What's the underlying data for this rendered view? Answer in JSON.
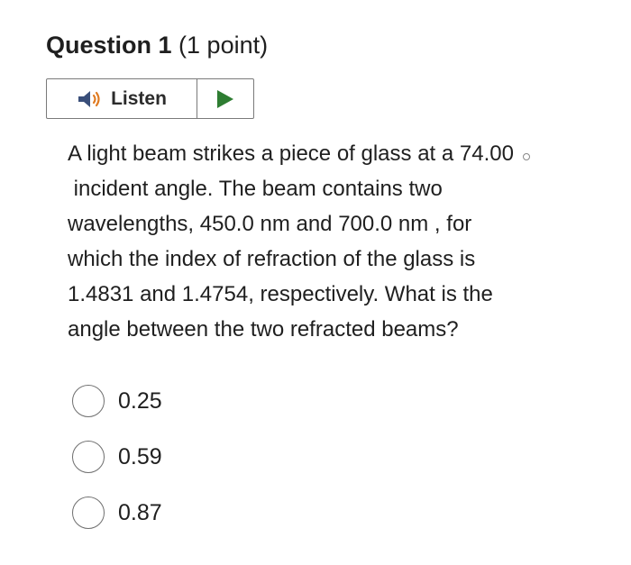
{
  "question": {
    "number_label": "Question 1",
    "points_label": "(1 point)"
  },
  "listen": {
    "label": "Listen",
    "speaker_icon": "speaker-icon",
    "play_icon": "play-icon",
    "play_color": "#2e7d32"
  },
  "body": {
    "line1": "A light beam strikes a piece of glass at a 74.00",
    "line2": "incident angle. The beam contains two",
    "line3": "wavelengths, 450.0  nm  and 700.0  nm , for",
    "line4": "which the index of refraction of the glass is",
    "line5": "1.4831 and 1.4754, respectively. What is the",
    "line6": "angle between the two refracted beams?"
  },
  "options": [
    {
      "label": "0.25"
    },
    {
      "label": "0.59"
    },
    {
      "label": "0.87"
    }
  ]
}
